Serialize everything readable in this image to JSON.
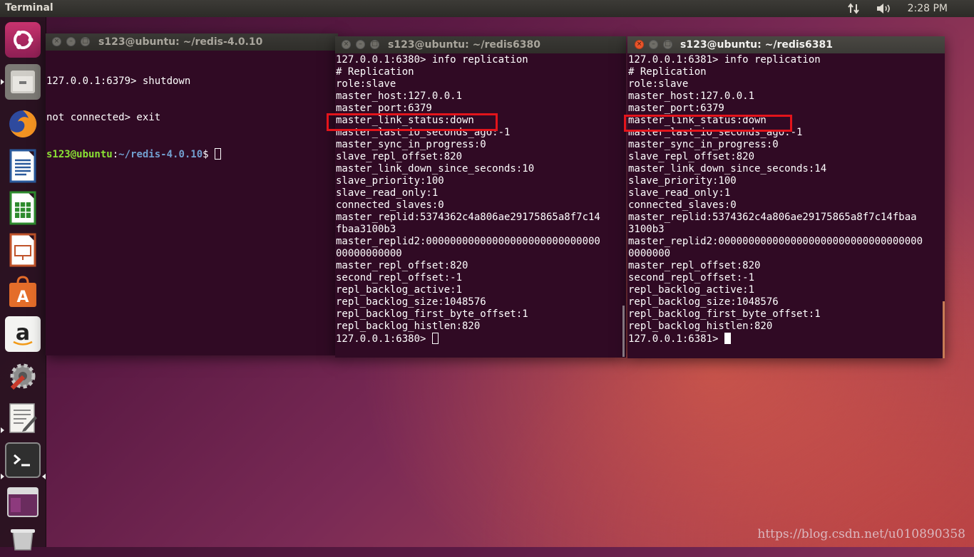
{
  "top_panel": {
    "app_title": "Terminal",
    "clock": "2:28 PM",
    "network_icon": "network-updown-icon",
    "volume_icon": "speaker-icon"
  },
  "launcher": {
    "items": [
      {
        "name": "ubuntu-dash"
      },
      {
        "name": "files"
      },
      {
        "name": "firefox"
      },
      {
        "name": "libreoffice-writer"
      },
      {
        "name": "libreoffice-calc"
      },
      {
        "name": "libreoffice-impress"
      },
      {
        "name": "ubuntu-software"
      },
      {
        "name": "amazon"
      },
      {
        "name": "system-settings"
      },
      {
        "name": "text-editor"
      },
      {
        "name": "terminal"
      },
      {
        "name": "workspace-switcher"
      },
      {
        "name": "trash"
      }
    ]
  },
  "windows": {
    "w1": {
      "title": "s123@ubuntu: ~/redis-4.0.10",
      "lines": [
        "127.0.0.1:6379> shutdown",
        "not connected> exit"
      ],
      "prompt_user": "s123@ubuntu",
      "prompt_sep": ":",
      "prompt_path": "~/redis-4.0.10",
      "prompt_end": "$ "
    },
    "w2": {
      "title": "s123@ubuntu: ~/redis6380",
      "lines": [
        "127.0.0.1:6380> info replication",
        "# Replication",
        "role:slave",
        "master_host:127.0.0.1",
        "master_port:6379",
        "master_link_status:down",
        "master_last_io_seconds_ago:-1",
        "master_sync_in_progress:0",
        "slave_repl_offset:820",
        "master_link_down_since_seconds:10",
        "slave_priority:100",
        "slave_read_only:1",
        "connected_slaves:0",
        "master_replid:5374362c4a806ae29175865a8f7c14",
        "fbaa3100b3",
        "master_replid2:00000000000000000000000000000",
        "00000000000",
        "master_repl_offset:820",
        "second_repl_offset:-1",
        "repl_backlog_active:1",
        "repl_backlog_size:1048576",
        "repl_backlog_first_byte_offset:1",
        "repl_backlog_histlen:820",
        "127.0.0.1:6380> "
      ]
    },
    "w3": {
      "title": "s123@ubuntu: ~/redis6381",
      "lines": [
        "127.0.0.1:6381> info replication",
        "# Replication",
        "role:slave",
        "master_host:127.0.0.1",
        "master_port:6379",
        "master_link_status:down",
        "master_last_io_seconds_ago:-1",
        "master_sync_in_progress:0",
        "slave_repl_offset:820",
        "master_link_down_since_seconds:14",
        "slave_priority:100",
        "slave_read_only:1",
        "connected_slaves:0",
        "master_replid:5374362c4a806ae29175865a8f7c14fbaa",
        "3100b3",
        "master_replid2:0000000000000000000000000000000000",
        "0000000",
        "master_repl_offset:820",
        "second_repl_offset:-1",
        "repl_backlog_active:1",
        "repl_backlog_size:1048576",
        "repl_backlog_first_byte_offset:1",
        "repl_backlog_histlen:820",
        "127.0.0.1:6381> "
      ]
    }
  },
  "watermark": "https://blog.csdn.net/u010890358"
}
